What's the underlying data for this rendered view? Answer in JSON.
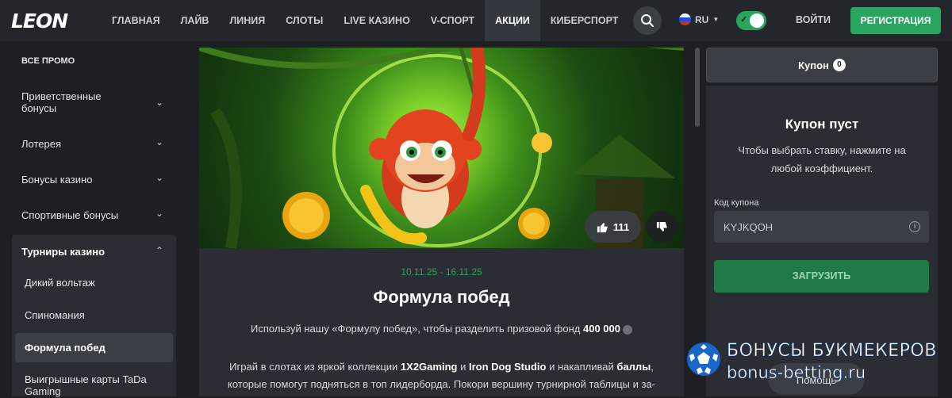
{
  "header": {
    "logo": "LEON",
    "nav": [
      "ГЛАВНАЯ",
      "ЛАЙВ",
      "ЛИНИЯ",
      "СЛОТЫ",
      "LIVE КАЗИНО",
      "V-СПОРТ",
      "АКЦИИ",
      "КИБЕРСПОРТ"
    ],
    "nav_active": "АКЦИИ",
    "more": "•••",
    "lang": "RU",
    "login": "ВОЙТИ",
    "register": "РЕГИСТРАЦИЯ"
  },
  "sidebar": {
    "all_promo": "ВСЕ ПРОМО",
    "items": [
      "Приветственные бонусы",
      "Лотерея",
      "Бонусы казино",
      "Спортивные бонусы"
    ],
    "group_title": "Турниры казино",
    "sub_items": [
      "Дикий вольтаж",
      "Спиномания",
      "Формула побед",
      "Выигрышные карты TaDa Gaming"
    ],
    "sub_active": "Формула побед"
  },
  "promo": {
    "likes": "111",
    "date": "10.11.25 - 16.11.25",
    "title": "Формула побед",
    "p1_text": "Используй нашу «Формулу побед», чтобы разделить призовой фонд",
    "p1_bold": "400 000",
    "p2_a": "Играй в слотах из яркой коллекции",
    "p2_b1": "1X2Gaming",
    "p2_and": "и",
    "p2_b2": "Iron Dog Studio",
    "p2_c": "и накапливай",
    "p2_b3": "баллы",
    "p2_d": ", которые помогут подняться в топ лидерборда. Покори вершину турнирной таблицы и за-"
  },
  "coupon": {
    "tab_label": "Купон",
    "count": "0",
    "empty_title": "Купон пуст",
    "empty_text": "Чтобы выбрать ставку, нажмите на любой коэффициент.",
    "code_label": "Код купона",
    "code_value": "KYJKQOH",
    "load_button": "ЗАГРУЗИТЬ",
    "help": "Помощь"
  },
  "watermark": {
    "line1": "БОНУСЫ БУКМЕКЕРОВ",
    "line2": "bonus-betting.ru"
  },
  "colors": {
    "accent_green": "#2aa55f",
    "background": "#1d1f24",
    "panel": "#2a2d33"
  }
}
